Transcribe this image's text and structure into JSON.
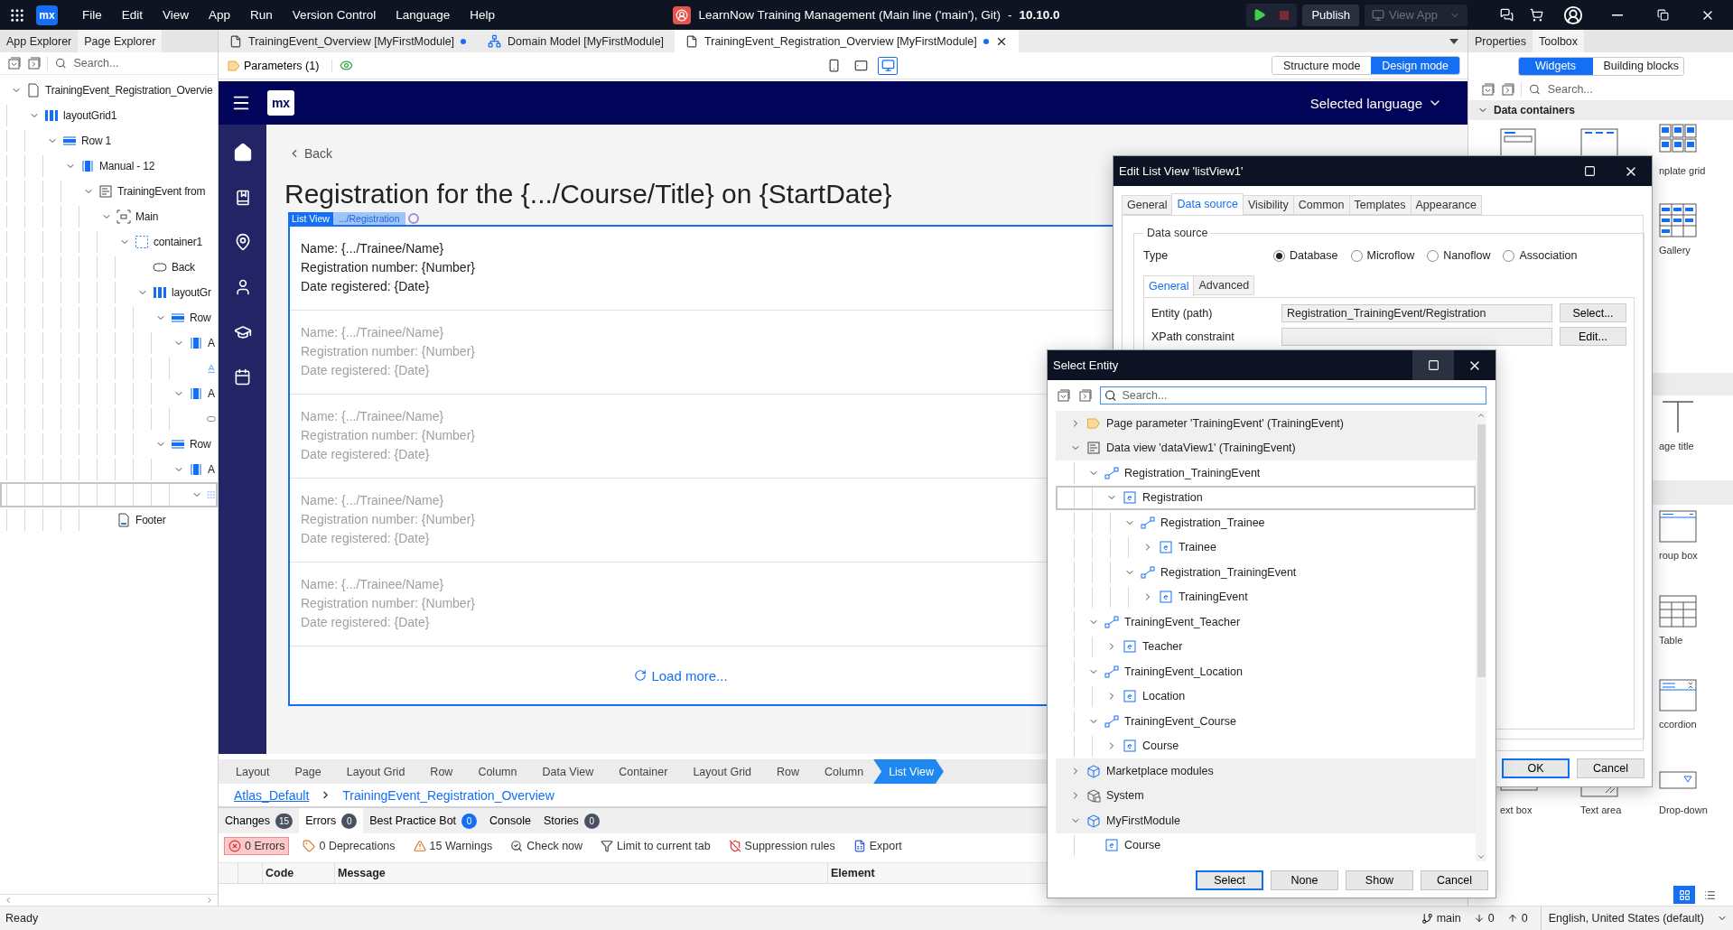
{
  "menu_bar": {
    "logo": "mx",
    "items": [
      "File",
      "Edit",
      "View",
      "App",
      "Run",
      "Version Control",
      "Language",
      "Help"
    ],
    "title": "LearnNow Training Management (Main line ('main'), Git)",
    "separator": "-",
    "version": "10.10.0",
    "publish": "Publish",
    "view_app": {
      "label": "View App",
      "disabled": true
    }
  },
  "left_panel": {
    "tabs": [
      {
        "label": "App Explorer",
        "selected": false
      },
      {
        "label": "Page Explorer",
        "selected": true
      }
    ],
    "search": {
      "placeholder": "Search..."
    },
    "tree": [
      {
        "label": "TrainingEvent_Registration_Overvie",
        "kind": "page",
        "expanded": true,
        "selected": false,
        "children": [
          {
            "label": "layoutGrid1",
            "kind": "grid",
            "expanded": true,
            "selected": false,
            "children": [
              {
                "label": "Row 1",
                "kind": "row",
                "expanded": true,
                "selected": false,
                "children": [
                  {
                    "label": "Manual - 12",
                    "kind": "column",
                    "expanded": true,
                    "selected": false,
                    "children": [
                      {
                        "label": "TrainingEvent from",
                        "kind": "dataview",
                        "expanded": true,
                        "selected": false,
                        "children": [
                          {
                            "label": "Main",
                            "kind": "placeholder",
                            "expanded": true,
                            "selected": false,
                            "children": [
                              {
                                "label": "container1",
                                "kind": "container",
                                "expanded": true,
                                "selected": false,
                                "children": [
                                  {
                                    "label": "Back",
                                    "kind": "button",
                                    "selected": false
                                  },
                                  {
                                    "label": "layoutGr",
                                    "kind": "grid",
                                    "expanded": true,
                                    "selected": false,
                                    "children": [
                                      {
                                        "label": "Row",
                                        "kind": "row",
                                        "expanded": true,
                                        "selected": false,
                                        "children": [
                                          {
                                            "label": "A",
                                            "kind": "column",
                                            "expanded": true,
                                            "selected": false,
                                            "children": [
                                              {
                                                "kind": "text",
                                                "selected": false
                                              }
                                            ]
                                          },
                                          {
                                            "label": "A",
                                            "kind": "column",
                                            "expanded": true,
                                            "selected": false,
                                            "children": [
                                              {
                                                "kind": "button",
                                                "selected": false
                                              }
                                            ]
                                          }
                                        ]
                                      },
                                      {
                                        "label": "Row",
                                        "kind": "row",
                                        "expanded": true,
                                        "selected": false,
                                        "children": [
                                          {
                                            "label": "A",
                                            "kind": "column",
                                            "expanded": true,
                                            "selected": false,
                                            "children": [
                                              {
                                                "kind": "listview",
                                                "expanded": true,
                                                "selected": true
                                              }
                                            ]
                                          }
                                        ]
                                      }
                                    ]
                                  }
                                ]
                              }
                            ]
                          },
                          {
                            "label": "Footer",
                            "kind": "footer",
                            "selected": false
                          }
                        ]
                      }
                    ]
                  }
                ]
              }
            ]
          }
        ]
      }
    ]
  },
  "editor_tabs": [
    {
      "label": "TrainingEvent_Overview [MyFirstModule]",
      "kind": "page",
      "modified": true,
      "selected": false
    },
    {
      "label": "Domain Model [MyFirstModule]",
      "kind": "domain",
      "modified": false,
      "selected": false
    },
    {
      "label": "TrainingEvent_Registration_Overview [MyFirstModule]",
      "kind": "page",
      "modified": true,
      "selected": true
    }
  ],
  "editor_toolbar": {
    "parameters": "Parameters (1)",
    "devices": [
      {
        "kind": "phone",
        "selected": false
      },
      {
        "kind": "tablet",
        "selected": false
      },
      {
        "kind": "desktop",
        "selected": true
      }
    ],
    "modes": [
      {
        "label": "Structure mode",
        "selected": false
      },
      {
        "label": "Design mode",
        "selected": true
      }
    ]
  },
  "canvas": {
    "logo": "mx",
    "language": "Selected language",
    "back": "Back",
    "title": "Registration for the {.../Course/Title} on {StartDate}",
    "list_view": {
      "tag": "List View",
      "path": ".../Registration",
      "items": [
        {
          "lines": [
            "Name: {.../Trainee/Name}",
            "Registration number: {Number}",
            "Date registered: {Date}"
          ],
          "disabled": false
        },
        {
          "lines": [
            "Name: {.../Trainee/Name}",
            "Registration number: {Number}",
            "Date registered: {Date}"
          ],
          "disabled": true
        },
        {
          "lines": [
            "Name: {.../Trainee/Name}",
            "Registration number: {Number}",
            "Date registered: {Date}"
          ],
          "disabled": true
        },
        {
          "lines": [
            "Name: {.../Trainee/Name}",
            "Registration number: {Number}",
            "Date registered: {Date}"
          ],
          "disabled": true
        },
        {
          "lines": [
            "Name: {.../Trainee/Name}",
            "Registration number: {Number}",
            "Date registered: {Date}"
          ],
          "disabled": true
        }
      ],
      "load_more": "Load more..."
    }
  },
  "breadcrumbs": [
    {
      "label": "Layout",
      "selected": false
    },
    {
      "label": "Page",
      "selected": false
    },
    {
      "label": "Layout Grid",
      "selected": false
    },
    {
      "label": "Row",
      "selected": false
    },
    {
      "label": "Column",
      "selected": false
    },
    {
      "label": "Data View",
      "selected": false
    },
    {
      "label": "Container",
      "selected": false
    },
    {
      "label": "Layout Grid",
      "selected": false
    },
    {
      "label": "Row",
      "selected": false
    },
    {
      "label": "Column",
      "selected": false
    },
    {
      "label": "List View",
      "selected": true
    }
  ],
  "layout_path": {
    "layout": "Atlas_Default",
    "page": "TrainingEvent_Registration_Overview"
  },
  "bottom_tabs": [
    {
      "label": "Changes",
      "count": "15",
      "color": "#4a5260",
      "selected": false
    },
    {
      "label": "Errors",
      "count": "0",
      "color": "#4a5260",
      "selected": true
    },
    {
      "label": "Best Practice Bot",
      "count": "0",
      "color": "#146ff4",
      "selected": false
    },
    {
      "label": "Console",
      "selected": false
    },
    {
      "label": "Stories",
      "count": "0",
      "color": "#4a5260",
      "selected": false
    }
  ],
  "error_toolbar": [
    {
      "kind": "errors",
      "label": "0 Errors",
      "selected": true
    },
    {
      "kind": "deprecations",
      "label": "0 Deprecations",
      "selected": false
    },
    {
      "kind": "warnings",
      "label": "15 Warnings",
      "selected": false
    },
    {
      "kind": "check",
      "label": "Check now",
      "selected": false
    },
    {
      "kind": "filter",
      "label": "Limit to current tab",
      "selected": false
    },
    {
      "kind": "suppression",
      "label": "Suppression rules",
      "selected": false
    },
    {
      "kind": "export",
      "label": "Export",
      "selected": false
    }
  ],
  "error_table": {
    "columns": [
      "Code",
      "Message",
      "Element"
    ]
  },
  "status_bar": {
    "text": "Ready",
    "branch": "main",
    "incoming": "0",
    "outgoing": "0",
    "language": "English, United States (default)"
  },
  "toolbox": {
    "tabs": [
      {
        "label": "Properties",
        "selected": false
      },
      {
        "label": "Toolbox",
        "selected": true
      }
    ],
    "modes": [
      {
        "label": "Widgets",
        "selected": true
      },
      {
        "label": "Building blocks",
        "selected": false
      }
    ],
    "search": {
      "placeholder": "Search..."
    },
    "section": {
      "label": "Data containers",
      "expanded": true
    },
    "rows": [
      {
        "items": [
          {
            "kind": "data-view"
          },
          {
            "kind": "list-view"
          },
          {
            "kind": "template-grid",
            "label": "nplate grid"
          }
        ]
      },
      {
        "items": [
          {
            "kind": "gallery",
            "label": "Gallery"
          }
        ]
      },
      {
        "kind": "band"
      },
      {
        "items": [
          {
            "kind": "page-title",
            "label": "age title"
          }
        ]
      },
      {
        "kind": "band"
      },
      {
        "items": [
          {
            "kind": "group-box",
            "label": "roup box"
          }
        ]
      },
      {
        "items": [
          {
            "kind": "table",
            "label": "Table"
          }
        ]
      },
      {
        "items": [
          {
            "kind": "accordion",
            "label": "ccordion"
          }
        ]
      },
      {
        "items": [
          {
            "kind": "text-box",
            "label": "ext box"
          },
          {
            "kind": "text-area",
            "label": "Text area"
          },
          {
            "kind": "drop-down",
            "label": "Drop-down"
          }
        ]
      }
    ]
  },
  "edit_list_view": {
    "title": "Edit List View 'listView1'",
    "tabs": [
      {
        "label": "General",
        "selected": false
      },
      {
        "label": "Data source",
        "selected": true
      },
      {
        "label": "Visibility",
        "selected": false
      },
      {
        "label": "Common",
        "selected": false
      },
      {
        "label": "Templates",
        "selected": false
      },
      {
        "label": "Appearance",
        "selected": false
      }
    ],
    "group": "Data source",
    "type_label": "Type",
    "type_options": [
      {
        "label": "Database",
        "selected": true
      },
      {
        "label": "Microflow",
        "selected": false
      },
      {
        "label": "Nanoflow",
        "selected": false
      },
      {
        "label": "Association",
        "selected": false
      }
    ],
    "subtabs": [
      {
        "label": "General",
        "selected": true
      },
      {
        "label": "Advanced",
        "selected": false
      }
    ],
    "fields": [
      {
        "label": "Entity (path)",
        "value": "Registration_TrainingEvent/Registration",
        "button": "Select..."
      },
      {
        "label": "XPath constraint",
        "button": "Edit..."
      }
    ],
    "buttons": [
      {
        "label": "OK",
        "primary": true
      },
      {
        "label": "Cancel",
        "primary": false
      }
    ]
  },
  "select_entity": {
    "title": "Select Entity",
    "search": {
      "placeholder": "Search..."
    },
    "tree": [
      {
        "label": "Page parameter 'TrainingEvent' (TrainingEvent)",
        "kind": "parameter",
        "expanded": false,
        "selected": false
      },
      {
        "label": "Data view 'dataView1' (TrainingEvent)",
        "kind": "dataview",
        "expanded": true,
        "selected": false,
        "children": [
          {
            "label": "Registration_TrainingEvent",
            "kind": "association",
            "expanded": true,
            "selected": false,
            "children": [
              {
                "label": "Registration",
                "kind": "entity",
                "expanded": true,
                "selected": true,
                "children": [
                  {
                    "label": "Registration_Trainee",
                    "kind": "association",
                    "expanded": true,
                    "selected": false,
                    "children": [
                      {
                        "label": "Trainee",
                        "kind": "entity",
                        "expanded": false,
                        "selected": false
                      }
                    ]
                  },
                  {
                    "label": "Registration_TrainingEvent",
                    "kind": "association",
                    "expanded": true,
                    "selected": false,
                    "children": [
                      {
                        "label": "TrainingEvent",
                        "kind": "entity",
                        "expanded": false,
                        "selected": false
                      }
                    ]
                  }
                ]
              }
            ]
          },
          {
            "label": "TrainingEvent_Teacher",
            "kind": "association",
            "expanded": true,
            "selected": false,
            "children": [
              {
                "label": "Teacher",
                "kind": "entity",
                "expanded": false,
                "selected": false
              }
            ]
          },
          {
            "label": "TrainingEvent_Location",
            "kind": "association",
            "expanded": true,
            "selected": false,
            "children": [
              {
                "label": "Location",
                "kind": "entity",
                "expanded": false,
                "selected": false
              }
            ]
          },
          {
            "label": "TrainingEvent_Course",
            "kind": "association",
            "expanded": true,
            "selected": false,
            "children": [
              {
                "label": "Course",
                "kind": "entity",
                "expanded": false,
                "selected": false
              }
            ]
          }
        ]
      },
      {
        "label": "Marketplace modules",
        "kind": "module",
        "expanded": false,
        "selected": false
      },
      {
        "label": "System",
        "kind": "system",
        "expanded": false,
        "selected": false
      },
      {
        "label": "MyFirstModule",
        "kind": "module",
        "expanded": true,
        "selected": false,
        "children": [
          {
            "label": "Course",
            "kind": "entity",
            "selected": false
          }
        ]
      }
    ],
    "buttons": [
      {
        "label": "Select",
        "primary": true
      },
      {
        "label": "None",
        "primary": false
      },
      {
        "label": "Show",
        "primary": false
      },
      {
        "label": "Cancel",
        "primary": false
      }
    ]
  }
}
